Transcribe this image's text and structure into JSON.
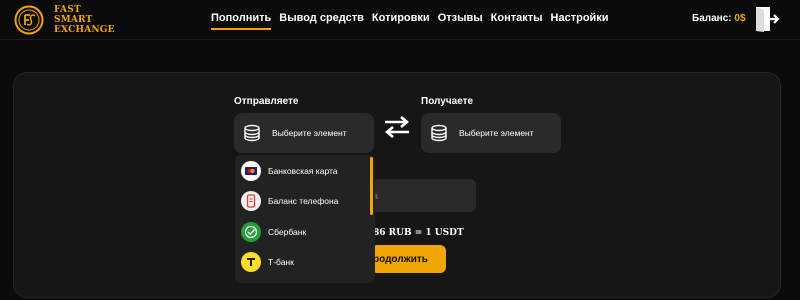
{
  "header": {
    "logo_lines": [
      "FAST",
      "SMART",
      "EXCHANGE"
    ],
    "nav": [
      "Пополнить",
      "Вывод средств",
      "Котировки",
      "Отзывы",
      "Контакты",
      "Настройки"
    ],
    "balance_label": "Баланс:",
    "balance_value": "0$"
  },
  "exchange": {
    "send_label": "Отправляете",
    "receive_label": "Получаете",
    "send_select": "Выберите элемент",
    "receive_select": "Выберите элемент",
    "amount_placeholder": "а",
    "rate_text": "86 RUB = 1 USDT",
    "continue_label": "родолжить"
  },
  "dropdown": {
    "items": [
      {
        "label": "Банковская карта",
        "icon": "bank-card-icon"
      },
      {
        "label": "Баланс телефона",
        "icon": "phone-balance-icon"
      },
      {
        "label": "Сбербанк",
        "icon": "sberbank-icon"
      },
      {
        "label": "Т-банк",
        "icon": "tbank-icon"
      }
    ]
  },
  "colors": {
    "accent": "#f0a500",
    "background": "#0b0b0b",
    "card": "#161616",
    "field": "#2a2a2a",
    "sber_green": "#21a038",
    "tbank_yellow": "#ffdd2d"
  }
}
